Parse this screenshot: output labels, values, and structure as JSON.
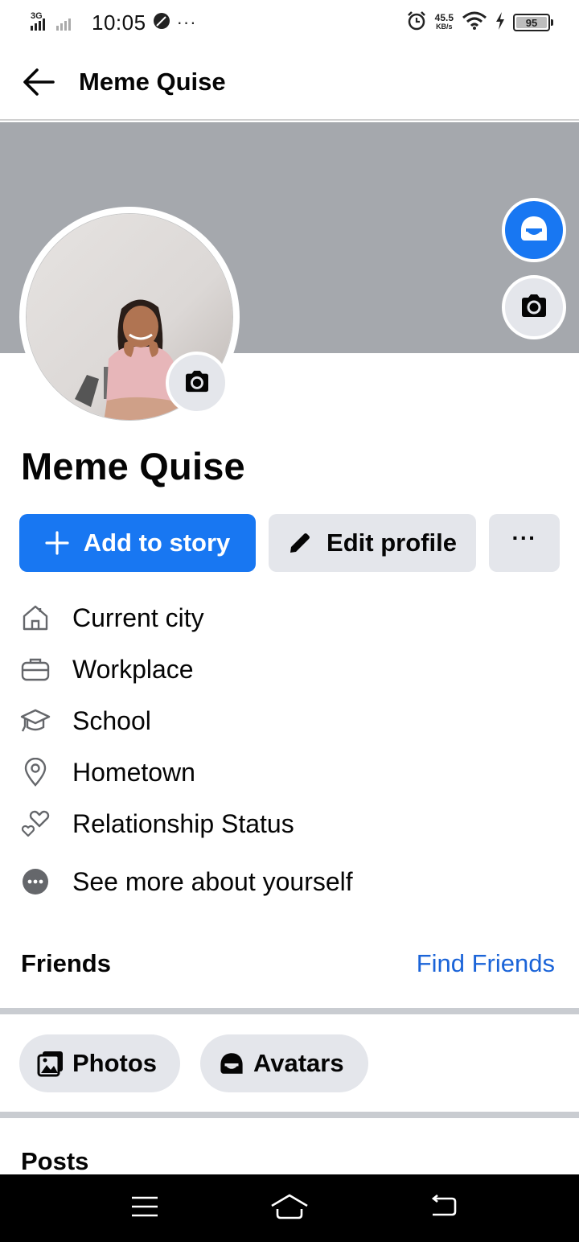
{
  "status_bar": {
    "network": "3G",
    "time": "10:05",
    "more": "···",
    "speed_value": "45.5",
    "speed_unit": "KB/s",
    "battery": "95"
  },
  "header": {
    "title": "Meme Quise"
  },
  "profile": {
    "name": "Meme Quise"
  },
  "actions": {
    "add_story": "Add to story",
    "edit_profile": "Edit profile",
    "more": "···"
  },
  "intro": [
    {
      "icon": "house-icon",
      "label": "Current city"
    },
    {
      "icon": "briefcase-icon",
      "label": "Workplace"
    },
    {
      "icon": "graduation-cap-icon",
      "label": "School"
    },
    {
      "icon": "location-pin-icon",
      "label": "Hometown"
    },
    {
      "icon": "hearts-icon",
      "label": "Relationship Status"
    },
    {
      "icon": "more-dots-icon",
      "label": "See more about yourself"
    }
  ],
  "friends": {
    "title": "Friends",
    "find_label": "Find Friends"
  },
  "chips": {
    "photos": "Photos",
    "avatars": "Avatars"
  },
  "posts": {
    "title": "Posts"
  },
  "colors": {
    "accent": "#1877f2",
    "link": "#1b64d8",
    "button_gray": "#e4e6eb",
    "cover_gray": "#a5a8ad"
  }
}
